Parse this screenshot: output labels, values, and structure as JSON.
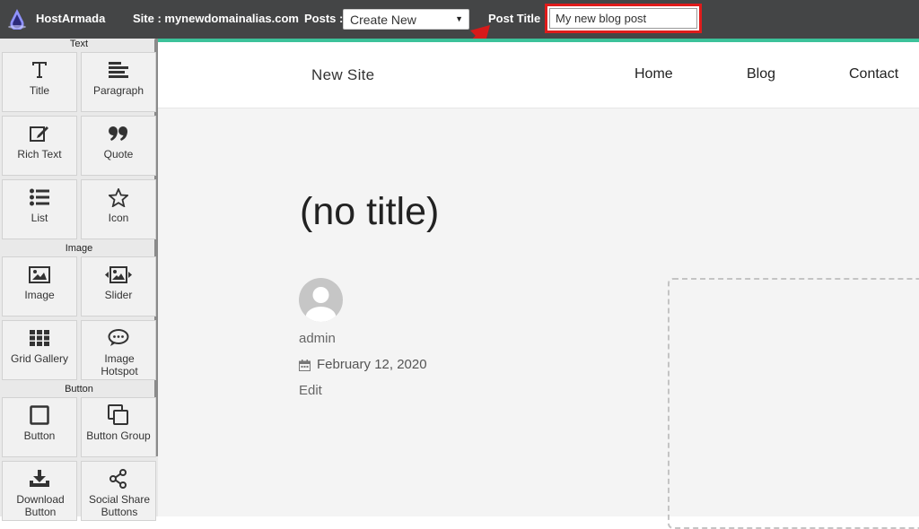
{
  "topbar": {
    "brand": "HostArmada",
    "site_label": "Site : mynewdomainalias.com",
    "posts_label": "Posts :",
    "posts_selected": "Create New",
    "post_title_label": "Post Title :",
    "post_title_value": "My new blog post",
    "highlight_color": "#e01b1b"
  },
  "sidebar": {
    "sections": [
      {
        "label": "Text",
        "items": [
          {
            "label": "Title",
            "icon": "title-icon"
          },
          {
            "label": "Paragraph",
            "icon": "paragraph-icon"
          },
          {
            "label": "Rich Text",
            "icon": "edit-icon"
          },
          {
            "label": "Quote",
            "icon": "quote-icon"
          },
          {
            "label": "List",
            "icon": "list-icon"
          },
          {
            "label": "Icon",
            "icon": "star-icon"
          }
        ]
      },
      {
        "label": "Image",
        "items": [
          {
            "label": "Image",
            "icon": "image-icon"
          },
          {
            "label": "Slider",
            "icon": "slider-icon"
          },
          {
            "label": "Grid Gallery",
            "icon": "grid-icon"
          },
          {
            "label": "Image Hotspot",
            "icon": "comment-icon"
          }
        ]
      },
      {
        "label": "Button",
        "items": [
          {
            "label": "Button",
            "icon": "square-icon"
          },
          {
            "label": "Button Group",
            "icon": "copy-icon"
          },
          {
            "label": "Download Button",
            "icon": "download-icon"
          },
          {
            "label": "Social Share Buttons",
            "icon": "share-icon"
          }
        ]
      }
    ]
  },
  "site": {
    "name": "New Site",
    "nav": [
      "Home",
      "Blog",
      "Contact"
    ],
    "accent_color": "#3cc29a"
  },
  "post": {
    "title": "(no title)",
    "author": "admin",
    "date": "February 12, 2020",
    "edit": "Edit"
  }
}
